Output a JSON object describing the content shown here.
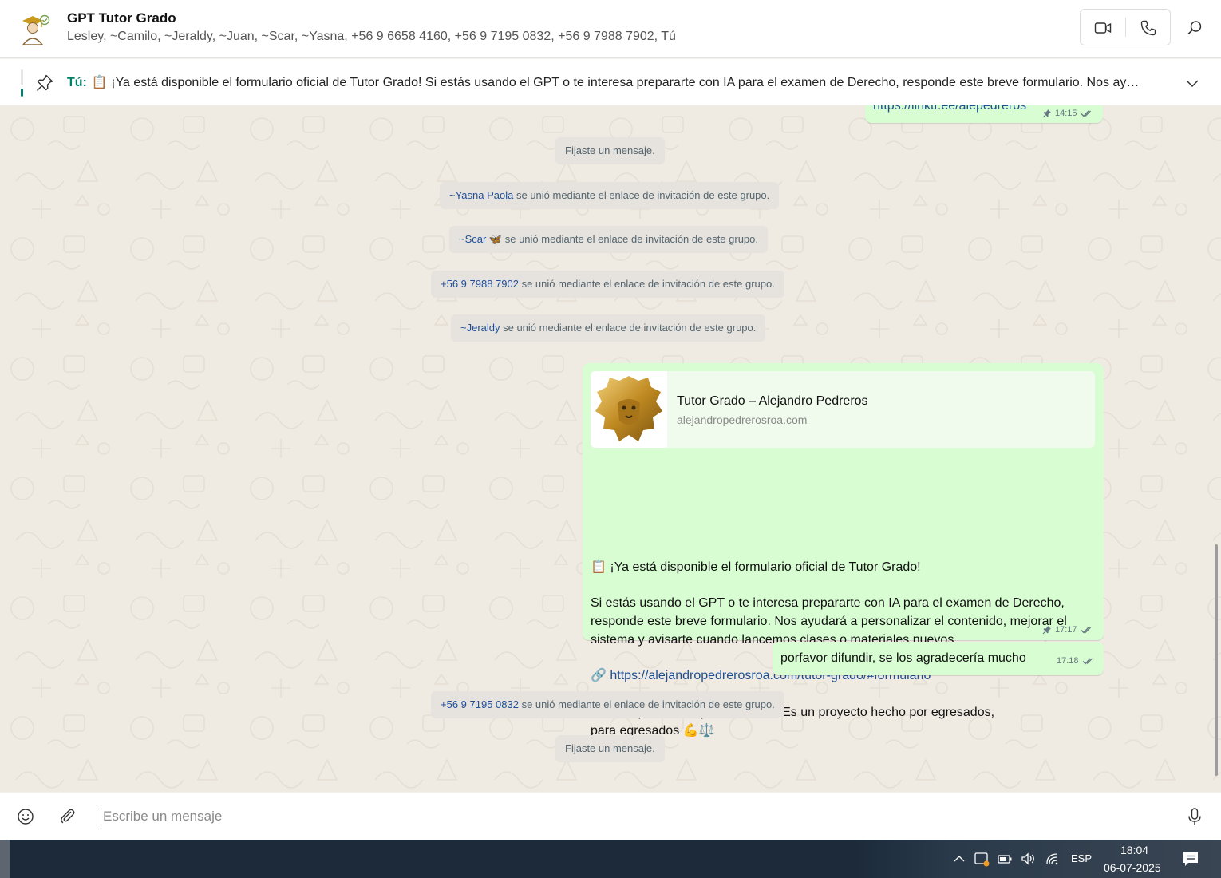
{
  "header": {
    "title": "GPT Tutor Grado",
    "members": "Lesley, ~Camilo, ~Jeraldy, ~Juan, ~Scar, ~Yasna, +56 9 6658 4160, +56 9 7195 0832, +56 9 7988 7902, Tú",
    "icons": [
      "group-avatar",
      "video-call-icon",
      "voice-call-icon",
      "search-icon"
    ]
  },
  "pinned": {
    "sender": "Tú:",
    "text": "📋 ¡Ya está disponible el formulario oficial de Tutor Grado!  Si estás usando el GPT o te interesa prepararte con IA para el examen de Derecho, responde este breve formulario. Nos ay…"
  },
  "messages": {
    "top_link": {
      "text": "https://linktr.ee/alepedreros",
      "time": "14:15"
    },
    "system": [
      {
        "who": "",
        "text": "Fijaste un mensaje."
      },
      {
        "who": "~Yasna Paola",
        "text": " se unió mediante el enlace de invitación de este grupo."
      },
      {
        "who": "~Scar 🦋",
        "text": " se unió mediante el enlace de invitación de este grupo."
      },
      {
        "who": "+56 9 7988 7902",
        "text": " se unió mediante el enlace de invitación de este grupo."
      },
      {
        "who": "~Jeraldy",
        "text": " se unió mediante el enlace de invitación de este grupo."
      },
      {
        "who": "+56 9 7195 0832",
        "text": " se unió mediante el enlace de invitación de este grupo."
      },
      {
        "who": "",
        "text": "Fijaste un mensaje."
      }
    ],
    "main": {
      "preview_title": "Tutor Grado – Alejandro Pedreros",
      "preview_domain": "alejandropedrerosroa.com",
      "line1": "📋 ¡Ya está disponible el formulario oficial de Tutor Grado!",
      "line2": "Si estás usando el GPT o te interesa prepararte con IA para el examen de Derecho,",
      "line3": "responde este breve formulario. Nos ayudará a personalizar el contenido, mejorar el",
      "line4": "sistema y avisarte cuando lancemos clases o materiales nuevos.",
      "link_emoji": "🔗",
      "link": "https://alejandropedrerosroa.com/tutor-grado/#formulario",
      "line5": "Gracias por formar parte de esto. Es un proyecto hecho por egresados,",
      "line6": "para egresados 💪⚖️",
      "time": "17:17"
    },
    "followup": {
      "text": "porfavor difundir, se los agradecería mucho",
      "time": "17:18"
    }
  },
  "composer": {
    "placeholder": "Escribe un mensaje"
  },
  "taskbar": {
    "lang": "ESP",
    "time": "18:04",
    "date": "06-07-2025"
  },
  "colors": {
    "bubble_out": "#d9fdd3",
    "accent": "#008069",
    "link": "#1d4f91",
    "chat_bg": "#efeae2"
  }
}
